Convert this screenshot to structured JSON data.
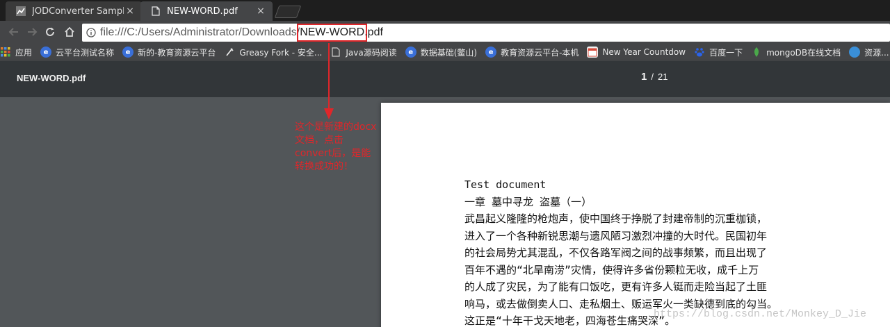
{
  "tabs": [
    {
      "title": "JODConverter Sample",
      "close": "×",
      "favicon": "jodconverter-icon"
    },
    {
      "title": "NEW-WORD.pdf",
      "close": "×",
      "favicon": "document-icon"
    }
  ],
  "address": {
    "url_prefix": "file:///C:/Users/Administrator/Downloads/",
    "url_highlight": "NEW-WORD",
    "url_suffix": ".pdf"
  },
  "bookmarks": [
    {
      "label": "应用",
      "icon": "apps-grid-icon",
      "color": "#e0a030"
    },
    {
      "label": "云平台测试名称",
      "icon": "globe-icon",
      "color": "#3a6fd8"
    },
    {
      "label": "新的-教育资源云平台",
      "icon": "globe-icon",
      "color": "#3a6fd8"
    },
    {
      "label": "Greasy Fork - 安全...",
      "icon": "greasyfork-icon",
      "color": "#888888"
    },
    {
      "label": "Java源码阅读",
      "icon": "page-icon",
      "color": "#cccccc"
    },
    {
      "label": "数据基础(鳖山)",
      "icon": "globe-icon",
      "color": "#3a6fd8"
    },
    {
      "label": "教育资源云平台-本机",
      "icon": "globe-icon",
      "color": "#3a6fd8"
    },
    {
      "label": "New Year Countdow",
      "icon": "calendar-icon",
      "color": "#d84a3a"
    },
    {
      "label": "百度一下",
      "icon": "baidu-icon",
      "color": "#2b63e8"
    },
    {
      "label": "mongoDB在线文档",
      "icon": "leaf-icon",
      "color": "#4aa84a"
    },
    {
      "label": "资源...",
      "icon": "globe-icon",
      "color": "#3a8fd8"
    }
  ],
  "pdf": {
    "title": "NEW-WORD.pdf",
    "current_page": "1",
    "separator": "/",
    "total_pages": "21"
  },
  "document": {
    "lines": [
      "Test document",
      "一章 墓中寻龙 盗墓（一）",
      "武昌起义隆隆的枪炮声，使中国终于挣脱了封建帝制的沉重枷锁，",
      "进入了一个各种新锐思潮与遗风陋习激烈冲撞的大时代。民国初年",
      "的社会局势尤其混乱，不仅各路军阀之间的战事频繁，而且出现了",
      "百年不遇的“北旱南涝”灾情，使得许多省份颗粒无收，成千上万",
      "的人成了灾民，为了能有口饭吃，更有许多人铤而走险当起了土匪",
      "响马，或去做倒卖人口、走私烟土、贩运军火一类缺德到底的勾当。",
      "这正是“十年干戈天地老，四海苍生痛哭深”。"
    ]
  },
  "watermark": "https://blog.csdn.net/Monkey_D_Jie",
  "annotation": {
    "lines": [
      "这个是新建的docx",
      "文档，点击",
      "convert后，是能",
      "转换成功的！"
    ],
    "color": "#e0262a"
  }
}
